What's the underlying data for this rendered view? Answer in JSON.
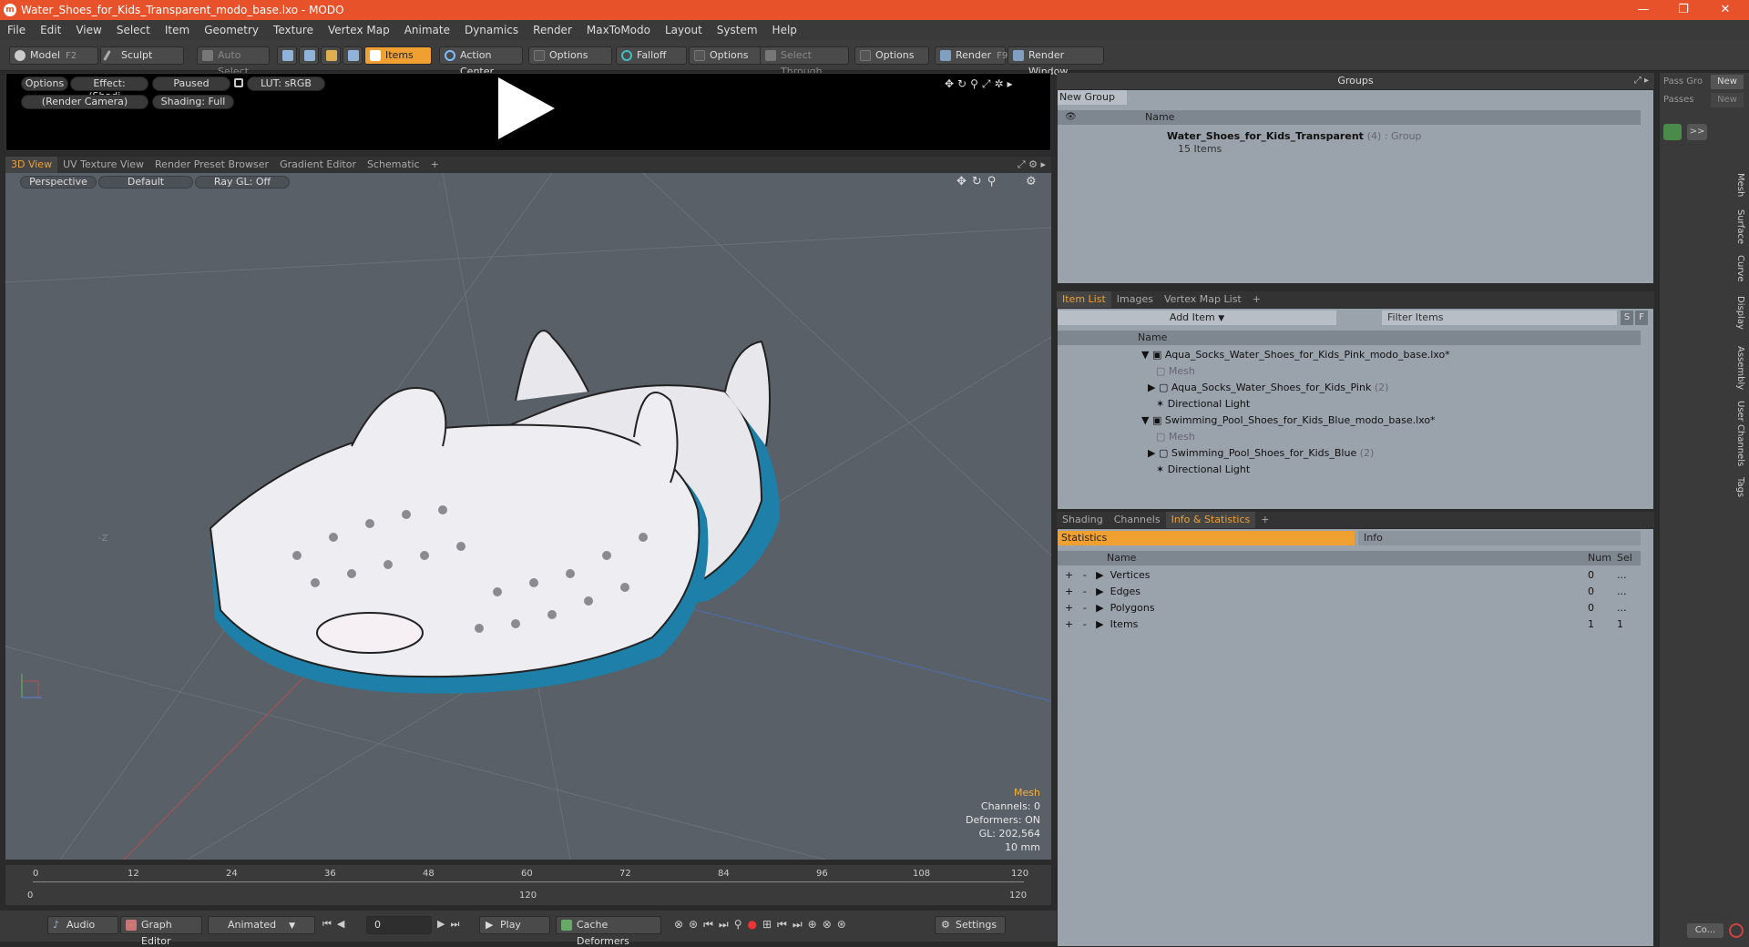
{
  "window": {
    "title": "Water_Shoes_for_Kids_Transparent_modo_base.lxo - MODO",
    "controls": [
      "—",
      "❐",
      "✕"
    ]
  },
  "menu": [
    "File",
    "Edit",
    "View",
    "Select",
    "Item",
    "Geometry",
    "Texture",
    "Vertex Map",
    "Animate",
    "Dynamics",
    "Render",
    "MaxToModo",
    "Layout",
    "System",
    "Help"
  ],
  "toolbar": {
    "model": "Model",
    "model_key": "F2",
    "sculpt": "Sculpt",
    "auto_select": "Auto Select",
    "items": "Items",
    "action_center": "Action Center",
    "options1": "Options",
    "falloff": "Falloff",
    "options2": "Options",
    "select_through": "Select Through",
    "options3": "Options",
    "render": "Render",
    "render_key": "F9",
    "render_window": "Render Window"
  },
  "preview": {
    "options": "Options",
    "effect": "Effect: (Shadi...",
    "paused": "Paused",
    "lut": "LUT: sRGB",
    "camera": "(Render Camera)",
    "shading": "Shading: Full"
  },
  "viewport_tabs": [
    "3D View",
    "UV Texture View",
    "Render Preset Browser",
    "Gradient Editor",
    "Schematic",
    "+"
  ],
  "viewport": {
    "perspective": "Perspective",
    "default": "Default",
    "raygl": "Ray GL: Off",
    "axis_label": "-Z",
    "stats": {
      "mesh": "Mesh",
      "channels": "Channels: 0",
      "deformers": "Deformers: ON",
      "gl": "GL: 202,564",
      "scale": "10 mm"
    }
  },
  "timeline": {
    "ticks_top": [
      "0",
      "12",
      "24",
      "36",
      "48",
      "60",
      "72",
      "84",
      "96",
      "108",
      "120"
    ],
    "ticks_bottom": [
      "0",
      "120",
      "120"
    ]
  },
  "bottombar": {
    "audio": "Audio",
    "graph_editor": "Graph Editor",
    "animated": "Animated",
    "frame": "0",
    "play": "Play",
    "cache": "Cache Deformers",
    "settings": "Settings"
  },
  "groups": {
    "title": "Groups",
    "new_group": "New Group",
    "col_name": "Name",
    "group_name": "Water_Shoes_for_Kids_Transparent",
    "group_meta": "(4) : Group",
    "group_count": "15 Items"
  },
  "passes": {
    "pass_groups": "Pass Gro",
    "passes": "Passes",
    "new1": "New",
    "new2": "New"
  },
  "itemlist": {
    "tabs": [
      "Item List",
      "Images",
      "Vertex Map List",
      "+"
    ],
    "add_item": "Add Item",
    "filter": "Filter Items",
    "s": "S",
    "f": "F",
    "col_name": "Name",
    "rows": [
      {
        "label": "Aqua_Socks_Water_Shoes_for_Kids_Pink_modo_base.lxo*",
        "suffix": "",
        "muted": false
      },
      {
        "label": "Mesh",
        "suffix": "",
        "muted": true
      },
      {
        "label": "Aqua_Socks_Water_Shoes_for_Kids_Pink",
        "suffix": "(2)",
        "muted": false
      },
      {
        "label": "Directional Light",
        "suffix": "",
        "muted": false
      },
      {
        "label": "Swimming_Pool_Shoes_for_Kids_Blue_modo_base.lxo*",
        "suffix": "",
        "muted": false
      },
      {
        "label": "Mesh",
        "suffix": "",
        "muted": true
      },
      {
        "label": "Swimming_Pool_Shoes_for_Kids_Blue",
        "suffix": "(2)",
        "muted": false
      },
      {
        "label": "Directional Light",
        "suffix": "",
        "muted": false
      }
    ]
  },
  "stats": {
    "tabs": [
      "Shading",
      "Channels",
      "Info & Statistics",
      "+"
    ],
    "statistics": "Statistics",
    "info": "Info",
    "col_name": "Name",
    "col_num": "Num",
    "col_sel": "Sel",
    "rows": [
      {
        "name": "Vertices",
        "num": "0",
        "sel": "..."
      },
      {
        "name": "Edges",
        "num": "0",
        "sel": "..."
      },
      {
        "name": "Polygons",
        "num": "0",
        "sel": "..."
      },
      {
        "name": "Items",
        "num": "1",
        "sel": "1"
      }
    ]
  },
  "rightstrip": {
    "vtabs": [
      "Mesh",
      "Surface",
      "Curve",
      "Display",
      "Assembly",
      "User Channels",
      "Tags"
    ],
    "co": "Co..."
  }
}
